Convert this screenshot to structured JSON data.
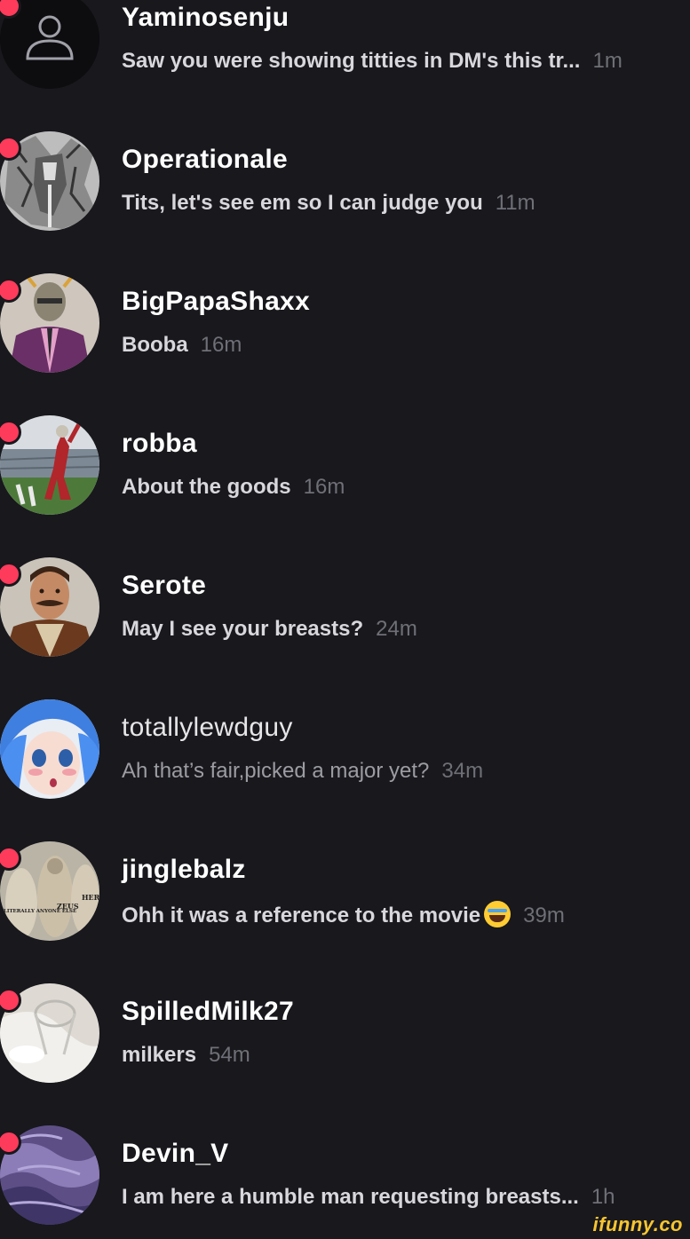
{
  "conversations": [
    {
      "name": "Yaminosenju",
      "message": "Saw you were showing titties in DM's this tr...",
      "time": "1m",
      "unread": true,
      "avatar": "default-user-icon"
    },
    {
      "name": "Operationale",
      "message": "Tits, let's see em so I can judge you",
      "time": "11m",
      "unread": true,
      "avatar": "armored-knight-sketch"
    },
    {
      "name": "BigPapaShaxx",
      "message": "Booba",
      "time": "16m",
      "unread": true,
      "avatar": "helmet-man-purple-suit"
    },
    {
      "name": "robba",
      "message": "About the goods",
      "time": "16m",
      "unread": true,
      "avatar": "football-player-stadium"
    },
    {
      "name": "Serote",
      "message": "May I see your breasts?",
      "time": "24m",
      "unread": true,
      "avatar": "mustached-man"
    },
    {
      "name": "totallylewdguy",
      "message": "Ah that’s fair,picked a major yet?",
      "time": "34m",
      "unread": false,
      "avatar": "anime-blue-hair-girl"
    },
    {
      "name": "jinglebalz",
      "message": "Ohh it was a reference to the movie",
      "time": "39m",
      "unread": true,
      "avatar": "greek-statues-meme",
      "emoji": "tears-of-joy"
    },
    {
      "name": "SpilledMilk27",
      "message": "milkers",
      "time": "54m",
      "unread": true,
      "avatar": "spilled-milk-glass"
    },
    {
      "name": "Devin_V",
      "message": "I am here a humble man requesting breasts...",
      "time": "1h",
      "unread": true,
      "avatar": "purple-fabric"
    }
  ],
  "avatar_text": {
    "jinglebalz": [
      "HERA",
      "ZEUS",
      "LITERALLY ANYONE ELSE"
    ]
  },
  "watermark": "ifunny.co",
  "colors": {
    "background": "#18181d",
    "unread_dot": "#ff3b5c",
    "name": "#ffffff",
    "preview": "#d8d8dc",
    "time": "#6f6f77",
    "watermark": "#f6c530"
  }
}
